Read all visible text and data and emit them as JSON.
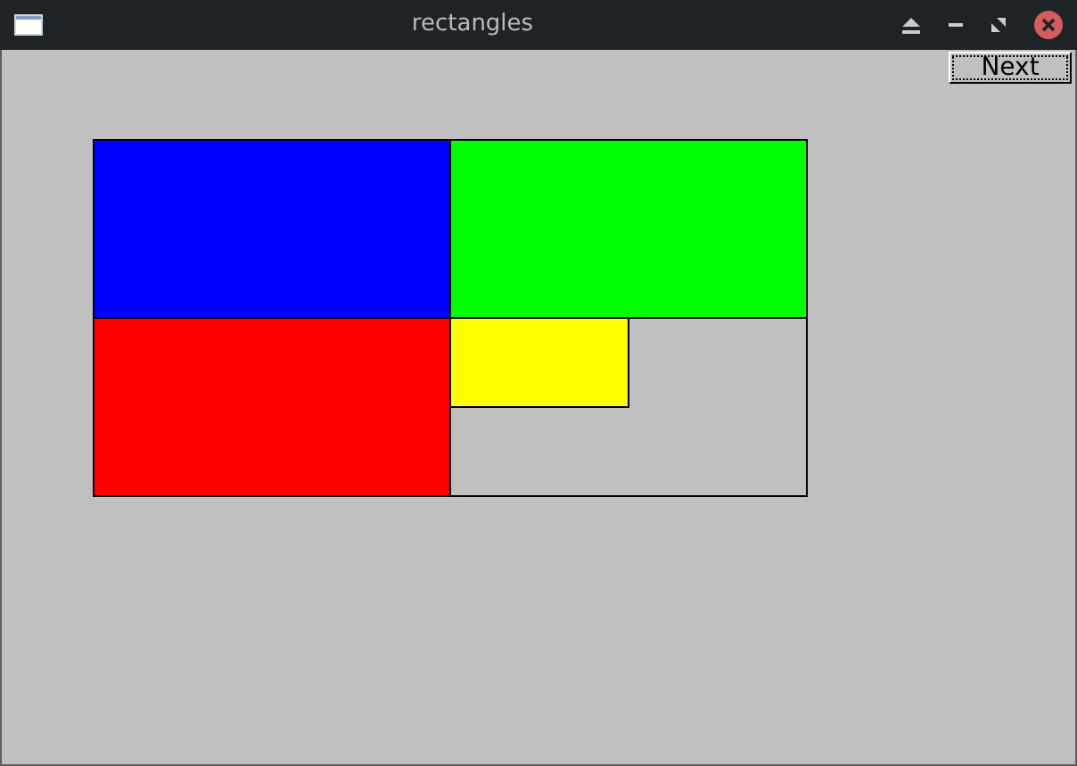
{
  "window": {
    "title": "rectangles"
  },
  "toolbar": {
    "button": "Next"
  },
  "canvas": {
    "rectangles": [
      {
        "color": "#0000ff"
      },
      {
        "color": "#00ff00"
      },
      {
        "color": "#ff0000"
      },
      {
        "color": "#c0c0c0"
      },
      {
        "color": "#ffff00"
      }
    ]
  }
}
